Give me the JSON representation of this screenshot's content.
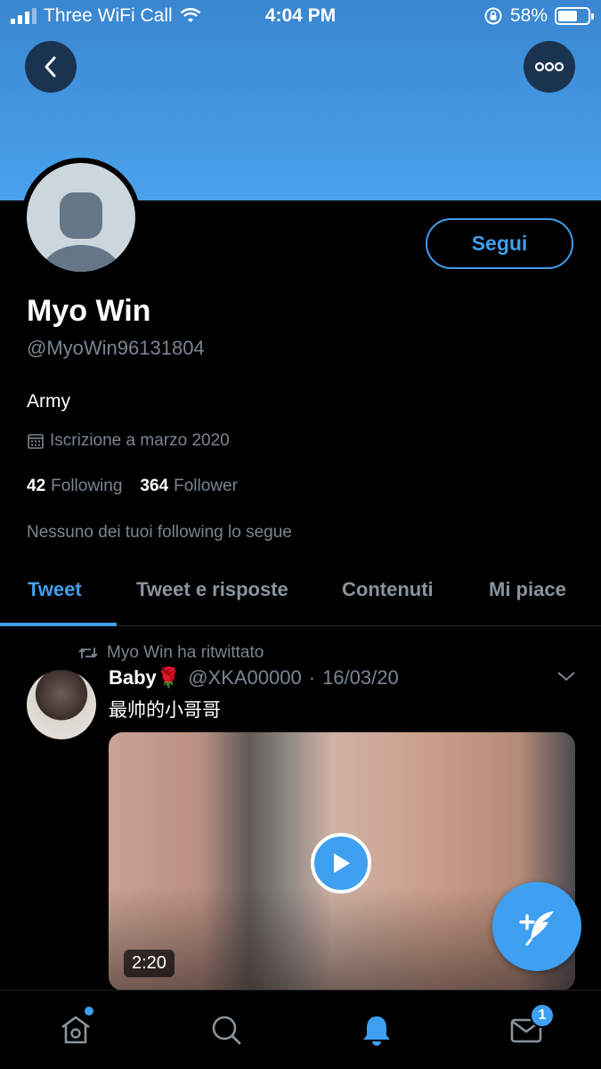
{
  "status_bar": {
    "carrier": "Three WiFi Call",
    "time": "4:04 PM",
    "battery": "58%",
    "battery_level": 0.58
  },
  "header": {
    "back_icon": "chevron-left-icon",
    "more_icon": "ellipsis-icon"
  },
  "profile": {
    "name": "Myo Win",
    "handle": "@MyoWin96131804",
    "bio": "Army",
    "joined": "Iscrizione a marzo 2020",
    "following_count": "42",
    "following_label": "Following",
    "follower_count": "364",
    "follower_label": "Follower",
    "followed_by_note": "Nessuno dei tuoi following lo segue",
    "follow_button": "Segui"
  },
  "tabs": [
    {
      "label": "Tweet",
      "active": true
    },
    {
      "label": "Tweet e risposte",
      "active": false
    },
    {
      "label": "Contenuti",
      "active": false
    },
    {
      "label": "Mi piace",
      "active": false
    }
  ],
  "tweet": {
    "retweet_note": "Myo Win ha ritwittato",
    "author_name": "Baby🌹",
    "author_handle": "@XKA00000",
    "separator": "·",
    "date": "16/03/20",
    "text": "最帅的小哥哥",
    "video_duration": "2:20"
  },
  "bottom_nav": {
    "items": [
      "home-icon",
      "search-icon",
      "notifications-icon",
      "messages-icon"
    ],
    "messages_badge": "1"
  },
  "colors": {
    "accent": "#3f9ff0",
    "banner": "#4aa2ec",
    "background": "#000000",
    "muted_text": "#7a8590"
  }
}
